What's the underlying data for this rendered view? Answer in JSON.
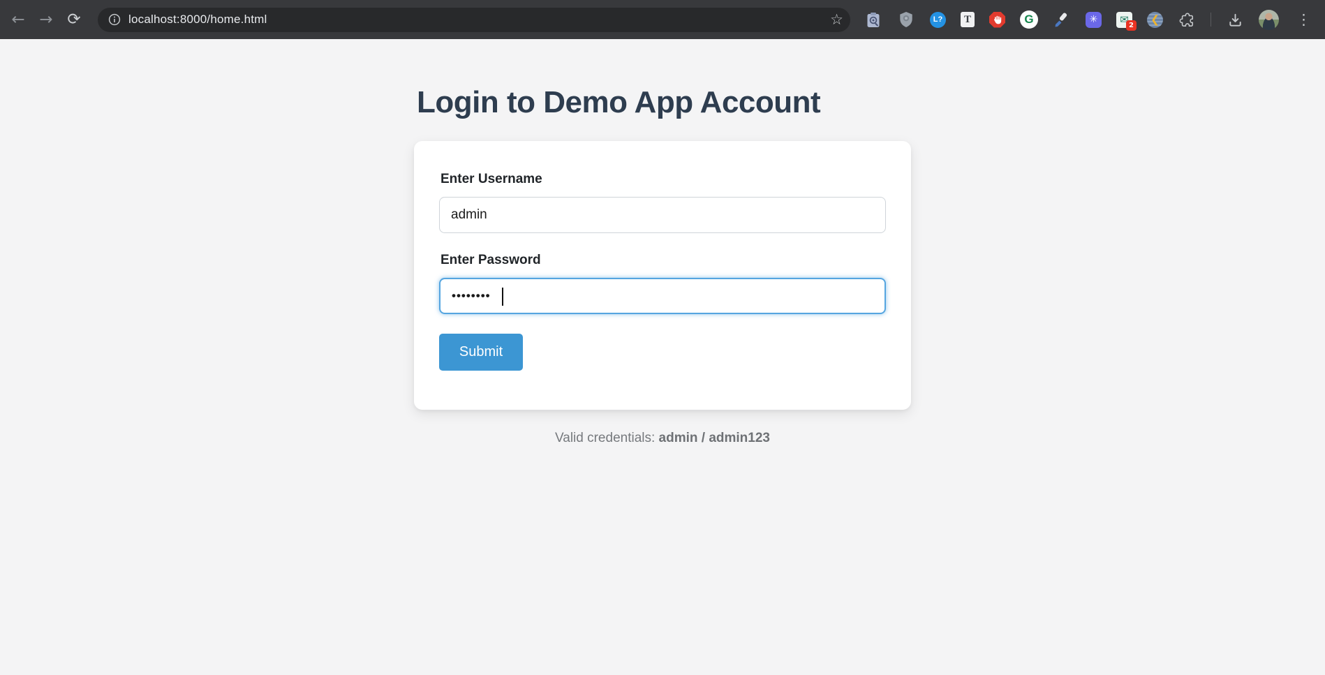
{
  "browser": {
    "url": "localhost:8000/home.html",
    "extensions": {
      "languagetool_glyph": "L?",
      "t_doc_glyph": "T",
      "grammarly_glyph": "G",
      "mail_badge_count": "2"
    }
  },
  "glyphs": {
    "back": "←",
    "forward": "→",
    "reload": "⟳",
    "star": "☆",
    "snowflake": "✳",
    "envelope": "✉",
    "share_arrow": "❮",
    "menu_dots": "⋮"
  },
  "login_page": {
    "heading": "Login to Demo App Account",
    "username": {
      "label": "Enter Username",
      "value": "admin"
    },
    "password": {
      "label": "Enter Password",
      "value": "••••••••"
    },
    "submit_label": "Submit",
    "hint_prefix": "Valid credentials: ",
    "hint_credentials": "admin / admin123"
  },
  "colors": {
    "accent_blue": "#3c96d3",
    "focus_ring_blue": "#55a5e0",
    "heading_color": "#2e3d4f",
    "toolbar_bg": "#38393c",
    "omnibox_bg": "#28292b",
    "page_bg": "#f4f4f5",
    "hint_gray": "#76797d"
  }
}
